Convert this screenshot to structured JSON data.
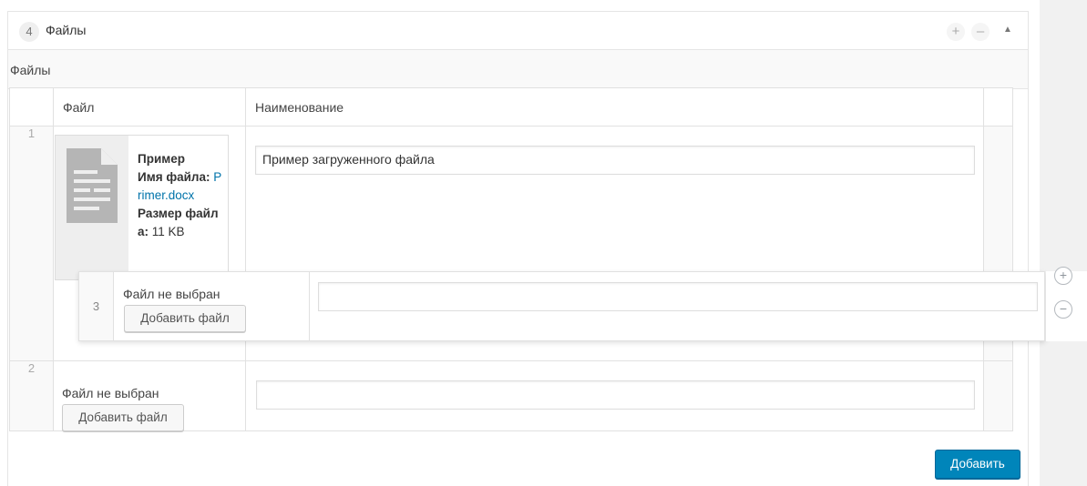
{
  "group": {
    "count": "4",
    "title": "Файлы",
    "add_symbol": "+",
    "remove_symbol": "–",
    "collapse_symbol": "▲"
  },
  "field_label": "Файлы",
  "table": {
    "columns": [
      "Файл",
      "Наименование"
    ]
  },
  "rows": [
    {
      "number": "1",
      "file": {
        "title": "Пример",
        "name_label": "Имя файла:",
        "name_value": "Primer.docx",
        "size_label": "Размер файла:",
        "size_value": "11 KB"
      },
      "name": "Пример загруженного файла"
    },
    {
      "number": "2",
      "no_file_text": "Файл не выбран",
      "add_file_label": "Добавить файл",
      "name": ""
    }
  ],
  "dragging_row": {
    "number": "3",
    "no_file_text": "Файл не выбран",
    "add_file_label": "Добавить файл",
    "name": ""
  },
  "row_actions": {
    "add_symbol": "+",
    "remove_symbol": "−"
  },
  "add_row_button": "Добавить",
  "icons": {
    "file": "document-icon",
    "add": "plus-icon",
    "remove": "minus-icon",
    "collapse": "triangle-up-icon"
  },
  "colors": {
    "primary": "#0085ba",
    "link": "#0073aa",
    "border": "#e1e1e1"
  }
}
